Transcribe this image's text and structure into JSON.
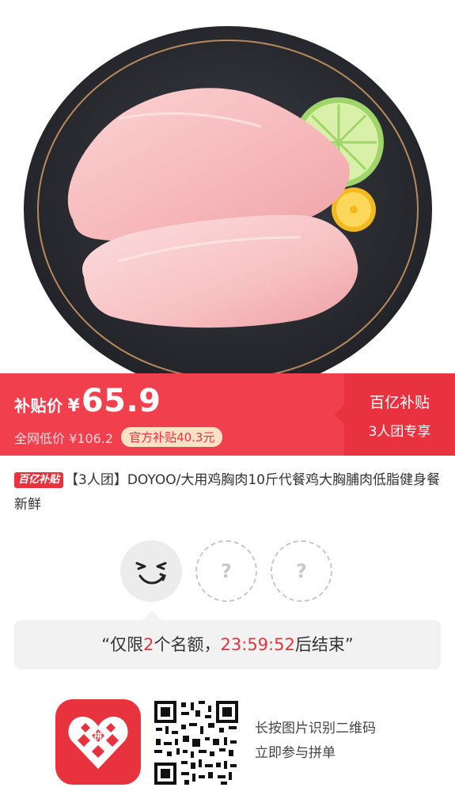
{
  "hero": {
    "alt": "chicken breast on dark plate with lime"
  },
  "price_bar": {
    "label": "补贴价",
    "currency": "¥",
    "price": "65.9",
    "original_price": "全网低价 ¥106.2",
    "subsidy": "官方补贴40.3元",
    "badge_line1": "百亿补贴",
    "badge_line2": "3人团专享",
    "colors": {
      "primary": "#f0404e",
      "badge": "#e8323f"
    }
  },
  "product": {
    "tag": "百亿补贴",
    "title": "【3人团】DOYOO/大用鸡胸肉10斤代餐鸡大胸脯肉低脂健身餐新鲜"
  },
  "group": {
    "members": [
      {
        "state": "joined",
        "icon": "smiley-face-icon"
      },
      {
        "state": "empty",
        "text": "?"
      },
      {
        "state": "empty",
        "text": "?"
      }
    ]
  },
  "limit": {
    "open_quote": "“",
    "prefix": "仅限",
    "count": "2",
    "middle": "个名额，",
    "time": "23:59:52",
    "suffix": "后结束",
    "close_quote": "”"
  },
  "footer": {
    "logo_icon": "pinduoduo-logo-icon",
    "qr_icon": "qr-code-icon",
    "line1": "长按图片识别二维码",
    "line2": "立即参与拼单"
  }
}
